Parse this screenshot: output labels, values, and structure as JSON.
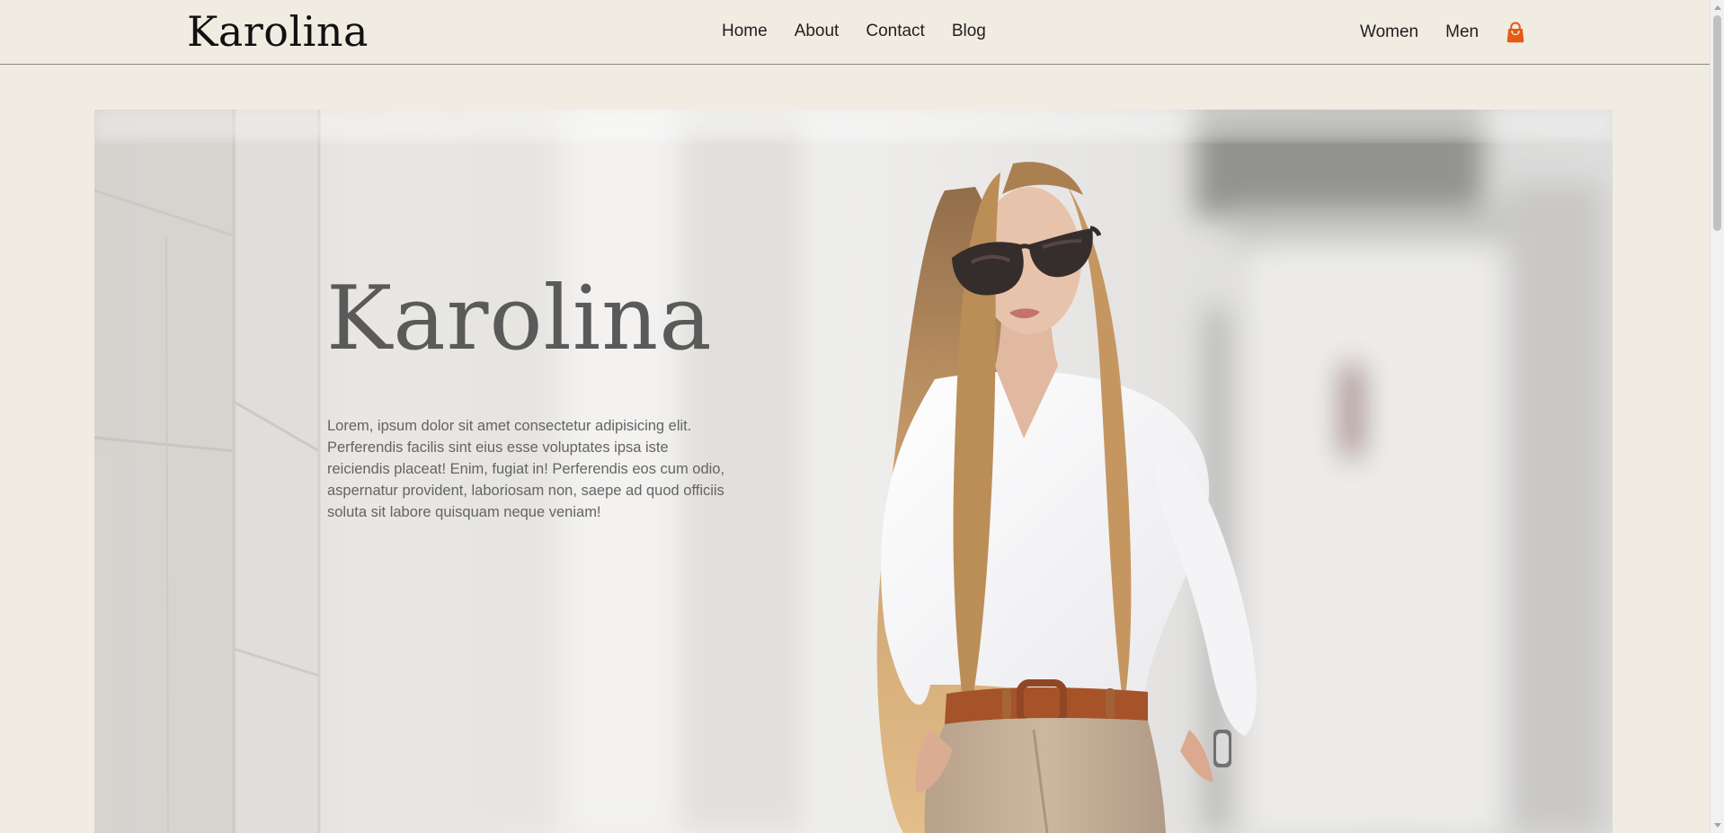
{
  "header": {
    "brand": "Karolina",
    "nav": [
      {
        "label": "Home"
      },
      {
        "label": "About"
      },
      {
        "label": "Contact"
      },
      {
        "label": "Blog"
      }
    ],
    "categories": [
      {
        "label": "Women"
      },
      {
        "label": "Men"
      }
    ],
    "cart_icon": "shopping-bag-icon",
    "cart_color": "#e65a13"
  },
  "hero": {
    "title": "Karolina",
    "copy": "Lorem, ipsum dolor sit amet consectetur adipisicing elit. Perferendis facilis sint eius esse voluptates ipsa iste reiciendis placeat! Enim, fugiat in! Perferendis eos cum odio, aspernatur provident, laboriosam non, saepe ad quod officiis soluta sit labore quisquam neque veniam!"
  }
}
